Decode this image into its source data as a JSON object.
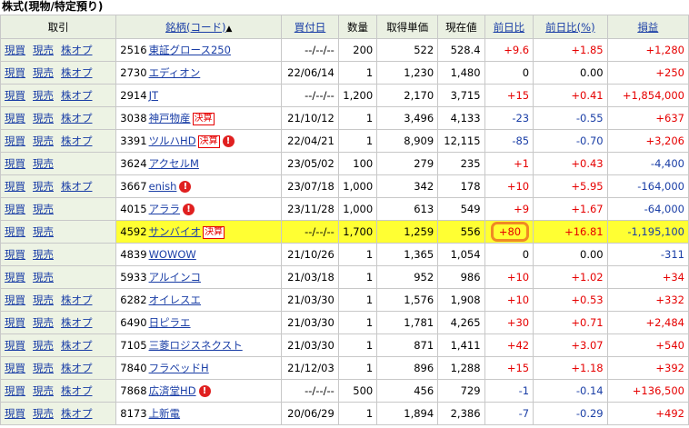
{
  "section_title": "株式(現物/特定預り)",
  "headers": {
    "trade": "取引",
    "stock": "銘柄(コード)",
    "sort_arrow": "▲",
    "buy_date": "買付日",
    "qty": "数量",
    "cost": "取得単価",
    "price": "現在値",
    "change": "前日比",
    "change_pct": "前日比(%)",
    "pl": "損益"
  },
  "actions": {
    "buy": "現買",
    "sell": "現売",
    "option": "株オプ"
  },
  "badges": {
    "kessan": "決算",
    "alert": "!"
  },
  "rows": [
    {
      "code": "2516",
      "name": "東証グロース250",
      "date": "--/--/--",
      "qty": "200",
      "cost": "522",
      "price": "528.4",
      "chg": "+9.6",
      "pct": "+1.85",
      "pl": "+1,280",
      "opt": true,
      "kessan": false,
      "alert": false,
      "hl": false
    },
    {
      "code": "2730",
      "name": "エディオン",
      "date": "22/06/14",
      "qty": "1",
      "cost": "1,230",
      "price": "1,480",
      "chg": "0",
      "pct": "0.00",
      "pl": "+250",
      "opt": true,
      "kessan": false,
      "alert": false,
      "hl": false
    },
    {
      "code": "2914",
      "name": "JT",
      "date": "--/--/--",
      "qty": "1,200",
      "cost": "2,170",
      "price": "3,715",
      "chg": "+15",
      "pct": "+0.41",
      "pl": "+1,854,000",
      "opt": true,
      "kessan": false,
      "alert": false,
      "hl": false
    },
    {
      "code": "3038",
      "name": "神戸物産",
      "date": "21/10/12",
      "qty": "1",
      "cost": "3,496",
      "price": "4,133",
      "chg": "-23",
      "pct": "-0.55",
      "pl": "+637",
      "opt": true,
      "kessan": true,
      "alert": false,
      "hl": false
    },
    {
      "code": "3391",
      "name": "ツルハHD",
      "date": "22/04/21",
      "qty": "1",
      "cost": "8,909",
      "price": "12,115",
      "chg": "-85",
      "pct": "-0.70",
      "pl": "+3,206",
      "opt": true,
      "kessan": true,
      "alert": true,
      "hl": false
    },
    {
      "code": "3624",
      "name": "アクセルM",
      "date": "23/05/02",
      "qty": "100",
      "cost": "279",
      "price": "235",
      "chg": "+1",
      "pct": "+0.43",
      "pl": "-4,400",
      "opt": false,
      "kessan": false,
      "alert": false,
      "hl": false
    },
    {
      "code": "3667",
      "name": "enish",
      "date": "23/07/18",
      "qty": "1,000",
      "cost": "342",
      "price": "178",
      "chg": "+10",
      "pct": "+5.95",
      "pl": "-164,000",
      "opt": true,
      "kessan": false,
      "alert": true,
      "hl": false
    },
    {
      "code": "4015",
      "name": "アララ",
      "date": "23/11/28",
      "qty": "1,000",
      "cost": "613",
      "price": "549",
      "chg": "+9",
      "pct": "+1.67",
      "pl": "-64,000",
      "opt": false,
      "kessan": false,
      "alert": true,
      "hl": false
    },
    {
      "code": "4592",
      "name": "サンバイオ",
      "date": "--/--/--",
      "qty": "1,700",
      "cost": "1,259",
      "price": "556",
      "chg": "+80",
      "pct": "+16.81",
      "pl": "-1,195,100",
      "opt": false,
      "kessan": true,
      "alert": false,
      "hl": true
    },
    {
      "code": "4839",
      "name": "WOWOW",
      "date": "21/10/26",
      "qty": "1",
      "cost": "1,365",
      "price": "1,054",
      "chg": "0",
      "pct": "0.00",
      "pl": "-311",
      "opt": false,
      "kessan": false,
      "alert": false,
      "hl": false
    },
    {
      "code": "5933",
      "name": "アルインコ",
      "date": "21/03/18",
      "qty": "1",
      "cost": "952",
      "price": "986",
      "chg": "+10",
      "pct": "+1.02",
      "pl": "+34",
      "opt": false,
      "kessan": false,
      "alert": false,
      "hl": false
    },
    {
      "code": "6282",
      "name": "オイレスエ",
      "date": "21/03/30",
      "qty": "1",
      "cost": "1,576",
      "price": "1,908",
      "chg": "+10",
      "pct": "+0.53",
      "pl": "+332",
      "opt": true,
      "kessan": false,
      "alert": false,
      "hl": false
    },
    {
      "code": "6490",
      "name": "日ピラエ",
      "date": "21/03/30",
      "qty": "1",
      "cost": "1,781",
      "price": "4,265",
      "chg": "+30",
      "pct": "+0.71",
      "pl": "+2,484",
      "opt": true,
      "kessan": false,
      "alert": false,
      "hl": false
    },
    {
      "code": "7105",
      "name": "三菱ロジスネクスト",
      "date": "21/03/30",
      "qty": "1",
      "cost": "871",
      "price": "1,411",
      "chg": "+42",
      "pct": "+3.07",
      "pl": "+540",
      "opt": true,
      "kessan": false,
      "alert": false,
      "hl": false
    },
    {
      "code": "7840",
      "name": "フラベッドH",
      "date": "21/12/03",
      "qty": "1",
      "cost": "896",
      "price": "1,288",
      "chg": "+15",
      "pct": "+1.18",
      "pl": "+392",
      "opt": true,
      "kessan": false,
      "alert": false,
      "hl": false
    },
    {
      "code": "7868",
      "name": "広済堂HD",
      "date": "--/--/--",
      "qty": "500",
      "cost": "456",
      "price": "729",
      "chg": "-1",
      "pct": "-0.14",
      "pl": "+136,500",
      "opt": true,
      "kessan": false,
      "alert": true,
      "hl": false
    },
    {
      "code": "8173",
      "name": "上新電",
      "date": "20/06/29",
      "qty": "1",
      "cost": "1,894",
      "price": "2,386",
      "chg": "-7",
      "pct": "-0.29",
      "pl": "+492",
      "opt": true,
      "kessan": false,
      "alert": false,
      "hl": false
    }
  ],
  "colors": {
    "positive": "#e60000",
    "negative": "#1a3ea6",
    "highlight": "#ffff33",
    "circle": "#f08a24",
    "header_bg": "#eaf0e2"
  }
}
